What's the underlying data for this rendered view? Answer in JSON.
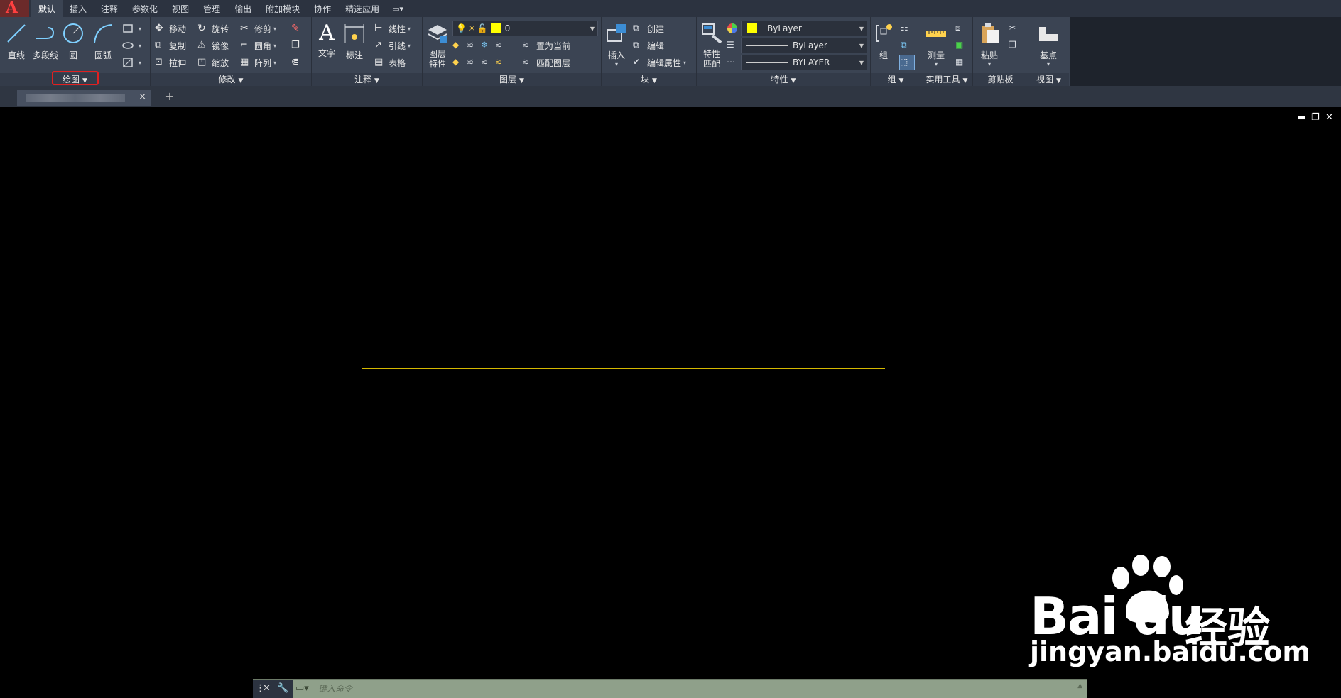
{
  "app": {
    "logo_letter": "A"
  },
  "tabs": [
    "默认",
    "插入",
    "注释",
    "参数化",
    "视图",
    "管理",
    "输出",
    "附加模块",
    "协作",
    "精选应用"
  ],
  "tab_extra": "▭▾",
  "panels": {
    "draw": {
      "label": "绘图",
      "buttons": {
        "line": "直线",
        "polyline": "多段线",
        "circle": "圆",
        "arc": "圆弧"
      }
    },
    "modify": {
      "label": "修改",
      "buttons": {
        "move": "移动",
        "rotate": "旋转",
        "trim": "修剪",
        "copy": "复制",
        "mirror": "镜像",
        "fillet": "圆角",
        "stretch": "拉伸",
        "scale": "缩放",
        "array": "阵列"
      }
    },
    "annotation": {
      "label": "注释",
      "buttons": {
        "text": "文字",
        "dimension": "标注",
        "linear": "线性",
        "leader": "引线",
        "table": "表格"
      }
    },
    "layers": {
      "label": "图层",
      "buttons": {
        "layer_props": "图层\n特性",
        "set_current": "置为当前",
        "match_layer": "匹配图层"
      },
      "current_layer": "0"
    },
    "block": {
      "label": "块",
      "buttons": {
        "insert": "插入",
        "create": "创建",
        "edit": "编辑",
        "edit_attr": "编辑属性"
      }
    },
    "properties": {
      "label": "特性",
      "buttons": {
        "match_props": "特性\n匹配"
      },
      "color": "ByLayer",
      "linetype": "ByLayer",
      "lineweight": "BYLAYER"
    },
    "groups": {
      "label": "组",
      "buttons": {
        "group": "组"
      }
    },
    "utilities": {
      "label": "实用工具",
      "buttons": {
        "measure": "测量"
      }
    },
    "clipboard": {
      "label": "剪贴板",
      "buttons": {
        "paste": "粘贴"
      }
    },
    "view": {
      "label": "视图",
      "buttons": {
        "base": "基点"
      }
    }
  },
  "colors": {
    "layer_color": "#ffff00",
    "line_color": "#d4b800",
    "highlight": "#e02020"
  },
  "document_tab": {
    "close": "×",
    "new": "+"
  },
  "window_controls": {
    "minimize": "▬",
    "restore": "❐",
    "close": "✕"
  },
  "command_line": {
    "placeholder": "键入命令"
  },
  "watermark": {
    "brand": "Bai du",
    "brand_cn": "经验",
    "url": "jingyan.baidu.com"
  }
}
